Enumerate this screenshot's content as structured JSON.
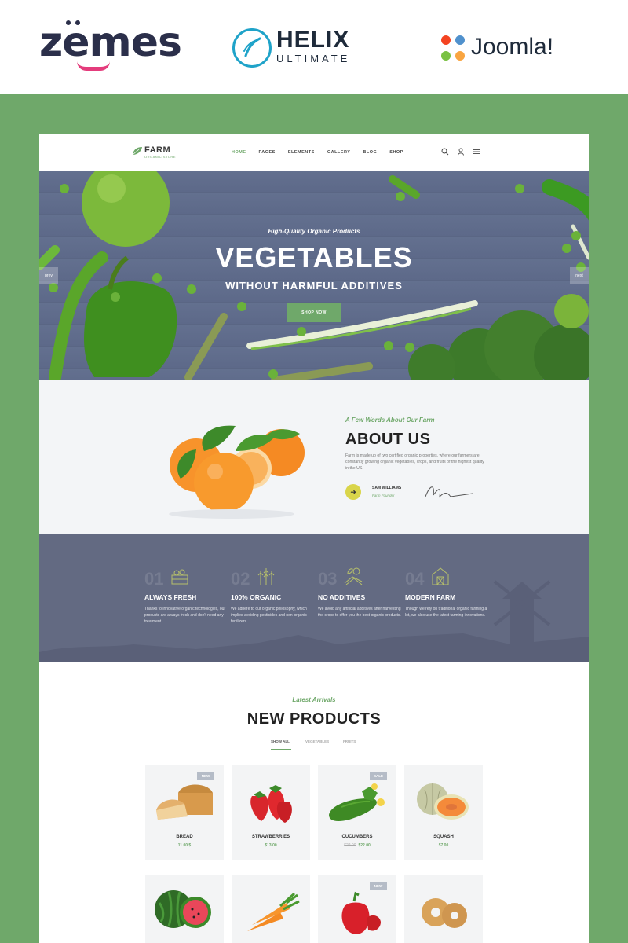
{
  "brands": {
    "zemes": "zemes",
    "helix_title": "HELIX",
    "helix_sub": "ULTIMATE",
    "joomla": "Joomla!"
  },
  "site": {
    "logo_name": "FARM",
    "logo_tag": "ORGANIC STORE",
    "menu": [
      "HOME",
      "PAGES",
      "ELEMENTS",
      "GALLERY",
      "BLOG",
      "SHOP"
    ],
    "active_menu": "HOME"
  },
  "hero": {
    "subtitle": "High-Quality Organic Products",
    "title": "VEGETABLES",
    "title2": "WITHOUT HARMFUL ADDITIVES",
    "button": "SHOP NOW",
    "prev": "prev",
    "next": "next"
  },
  "about": {
    "kicker": "A Few Words About Our Farm",
    "title": "ABOUT US",
    "text": "Farm is made up of two certified organic properties, where our farmers are constantly growing organic vegetables, crops, and fruits of the highest quality in the US.",
    "name": "SAM WILLIAMS",
    "role": "Farm Founder"
  },
  "features": [
    {
      "num": "01",
      "title": "ALWAYS FRESH",
      "text": "Thanks to innovative organic technologies, our products are always fresh and don't need any treatment.",
      "icon": "crate-icon"
    },
    {
      "num": "02",
      "title": "100% ORGANIC",
      "text": "We adhere to our organic philosophy, which implies avoiding pesticides and non-organic fertilizers.",
      "icon": "wheat-icon"
    },
    {
      "num": "03",
      "title": "NO ADDITIVES",
      "text": "We avoid any artificial additives after harvesting the crops to offer you the best organic products.",
      "icon": "field-icon"
    },
    {
      "num": "04",
      "title": "MODERN FARM",
      "text": "Though we rely on traditional organic farming a lot, we also use the latest farming innovations.",
      "icon": "barn-icon"
    }
  ],
  "products": {
    "kicker": "Latest Arrivals",
    "title": "NEW PRODUCTS",
    "tabs": [
      "SHOW ALL",
      "VEGETABLES",
      "FRUITS"
    ],
    "items": [
      {
        "name": "BREAD",
        "price": "11.00 $",
        "old_price": "",
        "badge": "NEW"
      },
      {
        "name": "STRAWBERRIES",
        "price": "$13.00",
        "old_price": "",
        "badge": ""
      },
      {
        "name": "CUCUMBERS",
        "price": "$22.00",
        "old_price": "$22.00",
        "badge": "SALE"
      },
      {
        "name": "SQUASH",
        "price": "$7.00",
        "old_price": "",
        "badge": ""
      },
      {
        "name": "",
        "price": "",
        "old_price": "",
        "badge": ""
      },
      {
        "name": "",
        "price": "",
        "old_price": "",
        "badge": ""
      },
      {
        "name": "",
        "price": "",
        "old_price": "",
        "badge": "NEW"
      },
      {
        "name": "",
        "price": "",
        "old_price": "",
        "badge": ""
      }
    ]
  },
  "colors": {
    "accent_green": "#6fa86a",
    "zemes_pink": "#e43c7c",
    "helix_blue": "#1fa3c9",
    "features_bg": "#636a82"
  }
}
